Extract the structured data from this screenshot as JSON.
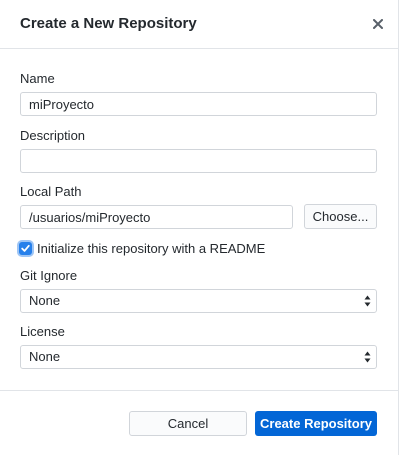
{
  "dialog": {
    "title": "Create a New Repository"
  },
  "fields": {
    "name": {
      "label": "Name",
      "value": "miProyecto"
    },
    "description": {
      "label": "Description",
      "value": ""
    },
    "local_path": {
      "label": "Local Path",
      "value": "/usuarios/miProyecto",
      "choose_label": "Choose..."
    },
    "readme": {
      "label": "Initialize this repository with a README",
      "checked": true
    },
    "git_ignore": {
      "label": "Git Ignore",
      "selected": "None"
    },
    "license": {
      "label": "License",
      "selected": "None"
    }
  },
  "actions": {
    "cancel_label": "Cancel",
    "create_label": "Create Repository"
  },
  "colors": {
    "primary_button": "#0366d6",
    "checkbox_accent": "#2680eb",
    "border": "#d1d5da"
  },
  "icons": {
    "close": "close-icon",
    "checkmark": "checkmark-icon",
    "select_arrows": "updown-arrows-icon"
  }
}
